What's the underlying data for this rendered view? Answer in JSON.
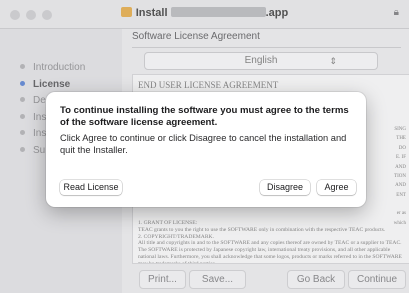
{
  "window": {
    "title_prefix": "Install",
    "title_suffix": ".app"
  },
  "sidebar": {
    "items": [
      {
        "label": "Introduction",
        "active": false
      },
      {
        "label": "License",
        "active": true
      },
      {
        "label": "De",
        "active": false
      },
      {
        "label": "Ins",
        "active": false
      },
      {
        "label": "Ins",
        "active": false
      },
      {
        "label": "Su",
        "active": false
      }
    ]
  },
  "main": {
    "heading": "Software License Agreement",
    "language": "English",
    "doc_title": "END USER LICENSE AGREEMENT",
    "doc_right": [
      "SING",
      "THE",
      "DO",
      "E. IF",
      "AND",
      "TION",
      "AND",
      "ENT",
      "er as",
      "which"
    ],
    "doc_body": [
      "1. GRANT OF LICENSE:",
      "TEAC grants to you the right to use the SOFTWARE only in combination with the respective TEAC products.",
      "2. COPYRIGHT/TRADEMARK.",
      "All title and copyrights in and to the SOFTWARE and any copies thereof are owned by TEAC or a supplier to TEAC. The SOFTWARE is protected by Japanese copyright law, international treaty provisions, and all other applicable national laws. Furthermore, you shall acknowledge that some logos, products or marks referred to in the SOFTWARE may be trademarks of third parties."
    ],
    "buttons": {
      "print": "Print...",
      "save": "Save...",
      "go_back": "Go Back",
      "continue": "Continue"
    }
  },
  "dialog": {
    "title": "To continue installing the software you must agree to the terms of the software license agreement.",
    "message": "Click Agree to continue or click Disagree to cancel the installation and quit the Installer.",
    "read_license": "Read License",
    "disagree": "Disagree",
    "agree": "Agree"
  },
  "colors": {
    "accent": "#6b8fd6",
    "package_icon": "#e6b35c"
  },
  "icons": [
    "package-icon",
    "lock-icon",
    "chevron-updown-icon"
  ]
}
